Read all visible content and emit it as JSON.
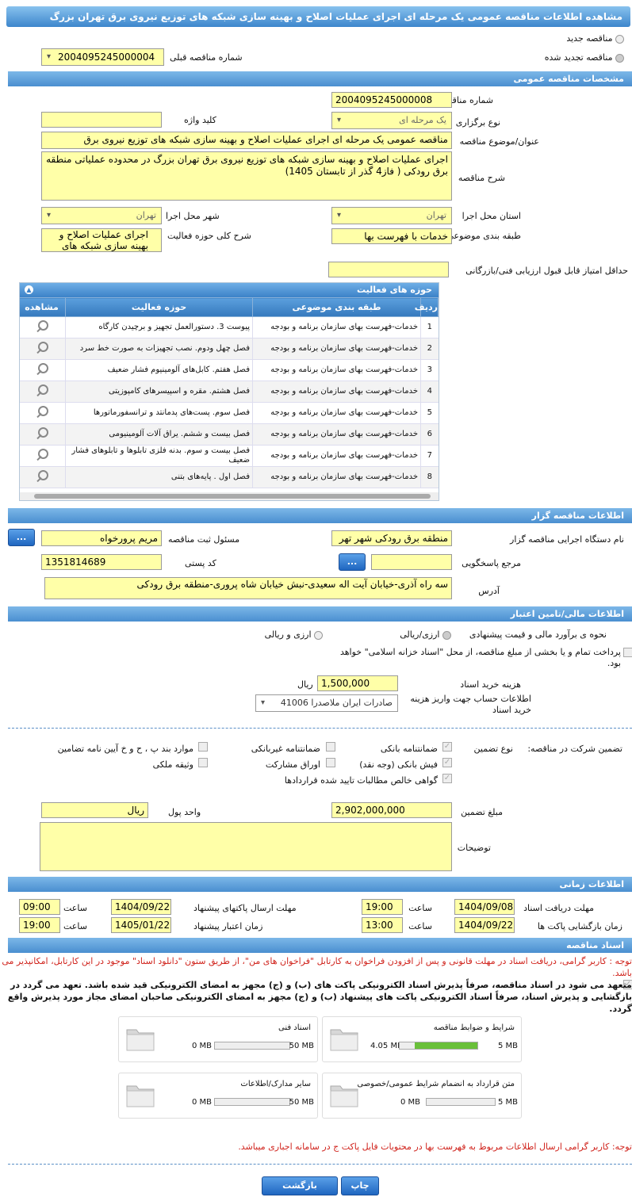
{
  "page_title": "مشاهده اطلاعات مناقصه عمومی یک مرحله ای اجرای عملیات اصلاح و بهینه سازی شبکه های توزیع نیروی برق تهران بزرگ",
  "tender_type": {
    "new_label": "مناقصه جدید",
    "renewed_label": "مناقصه تجدید شده",
    "prev_number_label": "شماره مناقصه قبلی",
    "prev_number": "2004095245000004"
  },
  "general": {
    "section_title": "مشخصات مناقصه عمومی",
    "number_label": "شماره مناقصه",
    "number": "2004095245000008",
    "holding_type_label": "نوع برگزاری",
    "holding_type": "یک مرحله ای",
    "keyword_label": "کلید واژه",
    "keyword": "",
    "subject_label": "عنوان/موضوع مناقصه",
    "subject": "مناقصه عمومی یک مرحله ای اجرای عملیات اصلاح و بهینه سازی شبکه های توزیع نیروی برق",
    "description_label": "شرح مناقصه",
    "description": "اجرای عملیات اصلاح و بهینه سازی شبکه های توزیع نیروی برق تهران بزرگ در محدوده عملیاتی منطقه برق رودکی ( فاز4 گذر از تابستان 1405)",
    "province_label": "استان محل اجرا",
    "province": "تهران",
    "city_label": "شهر محل اجرا",
    "city": "تهران",
    "category_label": "طبقه بندی موضوعی",
    "category": "خدمات با فهرست بها",
    "activity_desc_label": "شرح کلی حوزه فعالیت",
    "activity_desc": "اجرای عملیات اصلاح و بهینه سازی شبکه های",
    "min_score_label": "حداقل امتیاز قابل قبول ارزیابی فنی/بازرگانی",
    "min_score": ""
  },
  "activities": {
    "title": "حوزه های فعالیت",
    "headers": [
      "ردیف",
      "طبقه بندی موضوعی",
      "حوزه فعالیت",
      "مشاهده"
    ],
    "rows": [
      {
        "n": "1",
        "cat": "خدمات-فهرست بهای سازمان برنامه و بودجه",
        "field": "پیوست 3. دستورالعمل تجهیز و برچیدن کارگاه"
      },
      {
        "n": "2",
        "cat": "خدمات-فهرست بهای سازمان برنامه و بودجه",
        "field": "فصل چهل ودوم. نصب تجهیزات به صورت خط سرد"
      },
      {
        "n": "3",
        "cat": "خدمات-فهرست بهای سازمان برنامه و بودجه",
        "field": "فصل هفتم. کابل‌های آلومینیوم فشار ضعیف"
      },
      {
        "n": "4",
        "cat": "خدمات-فهرست بهای سازمان برنامه و بودجه",
        "field": "فصل هشتم. مقره و اسپیسرهای کامپوزیتی"
      },
      {
        "n": "5",
        "cat": "خدمات-فهرست بهای سازمان برنامه و بودجه",
        "field": "فصل سوم. پست‌های پدمانتد و ترانسفورماتورها"
      },
      {
        "n": "6",
        "cat": "خدمات-فهرست بهای سازمان برنامه و بودجه",
        "field": "فصل بیست و ششم. یراق آلات آلومینیومی"
      },
      {
        "n": "7",
        "cat": "خدمات-فهرست بهای سازمان برنامه و بودجه",
        "field": "فصل بیست و سوم. بدنه فلزی تابلوها و تابلوهای فشار ضعیف"
      },
      {
        "n": "8",
        "cat": "خدمات-فهرست بهای سازمان برنامه و بودجه",
        "field": "فصل اول . پایه‌های بتنی"
      }
    ]
  },
  "organizer": {
    "section_title": "اطلاعات مناقصه گزار",
    "device_label": "نام دستگاه اجرایی مناقصه گزار",
    "device": "منطقه برق رودکی شهر تهر",
    "registrar_label": "مسئول ثبت مناقصه",
    "registrar": "مریم پرورخواه",
    "reference_label": "مرجع پاسخگویی",
    "reference": "",
    "postal_label": "کد پستی",
    "postal": "1351814689",
    "address_label": "آدرس",
    "address": "سه راه آذری-خیابان آیت اله سعیدی-نبش خیابان شاه پروری-منطقه برق رودکی",
    "dots_label": "..."
  },
  "finance": {
    "section_title": "اطلاعات مالی/تامین اعتبار",
    "estimate_label": "نحوه ی برآورد مالی و قیمت پیشنهادی",
    "opt1": "ارزی/ریالی",
    "opt2": "ارزی و ریالی",
    "treasury_text": "پرداخت تمام و یا بخشی از مبلغ مناقصه، از محل \"اسناد خزانه اسلامی\" خواهد بود.",
    "fee_label": "هزینه خرید اسناد",
    "fee": "1,500,000",
    "fee_unit": "ریال",
    "account_label": "اطلاعات حساب جهت واریز هزینه خرید اسناد",
    "account": "صادرات ایران ملاصدرا 41006"
  },
  "guarantee": {
    "participation_label": "تضمین شرکت در مناقصه:",
    "type_label": "نوع تضمین",
    "opts": [
      "ضمانتنامه بانکی",
      "ضمانتنامه غیربانکی",
      "موارد بند پ ، ح و خ آیین نامه تضامین",
      "فیش بانکی (وجه نقد)",
      "اوراق مشارکت",
      "وثیقه ملکی",
      "گواهی خالص مطالبات تایید شده قراردادها"
    ],
    "amount_label": "مبلغ تضمین",
    "amount": "2,902,000,000",
    "unit_label": "واحد پول",
    "unit": "ریال",
    "notes_label": "توضیحات",
    "notes": ""
  },
  "timing": {
    "section_title": "اطلاعات زمانی",
    "receive_label": "مهلت دریافت اسناد",
    "receive_date": "1404/09/08",
    "receive_time": "19:00",
    "send_label": "مهلت ارسال پاکتهای پیشنهاد",
    "send_date": "1404/09/22",
    "send_time": "09:00",
    "open_label": "زمان بازگشایی پاکت ها",
    "open_date": "1404/09/22",
    "open_time": "13:00",
    "validity_label": "زمان اعتبار پیشنهاد",
    "validity_date": "1405/01/22",
    "validity_time": "19:00",
    "time_label": "ساعت"
  },
  "documents": {
    "section_title": "اسناد مناقصه",
    "notice": "توجه : کاربر گرامی، دریافت اسناد در مهلت قانونی و پس از افزودن فراخوان به کارتابل \"فراخوان های من\"، از طریق ستون \"دانلود اسناد\" موجود در این کارتابل، امکانپذیر می باشد.",
    "commit": "متعهد می شود در اسناد مناقصه، صرفاً پذیرش اسناد الکترونیکی پاکت های (ب) و (ج) مجهز به امضای الکترونیکی قید شده باشد. تعهد می گردد در بازگشایی و پذیرش اسناد، صرفاً اسناد الکترونیکی پاکت های پیشنهاد (ب) و (ج) مجهز به امضای الکترونیکی صاحبان امضای مجاز مورد پذیرش واقع گردد.",
    "items": [
      {
        "name": "شرایط و ضوابط مناقصه",
        "size": "4.05 MB",
        "max": "5 MB",
        "fill": 0.81
      },
      {
        "name": "اسناد فنی",
        "size": "0 MB",
        "max": "50 MB",
        "fill": 0
      },
      {
        "name": "متن قرارداد به انضمام شرایط عمومی/خصوصی",
        "size": "0 MB",
        "max": "5 MB",
        "fill": 0
      },
      {
        "name": "سایر مدارک/اطلاعات",
        "size": "0 MB",
        "max": "50 MB",
        "fill": 0
      }
    ],
    "footer_notice": "توجه: کاربر گرامی ارسال اطلاعات مربوط به فهرست بها در محتویات فایل پاکت ج در سامانه اجباری میباشد."
  },
  "actions": {
    "back": "بازگشت",
    "print": "چاپ"
  }
}
